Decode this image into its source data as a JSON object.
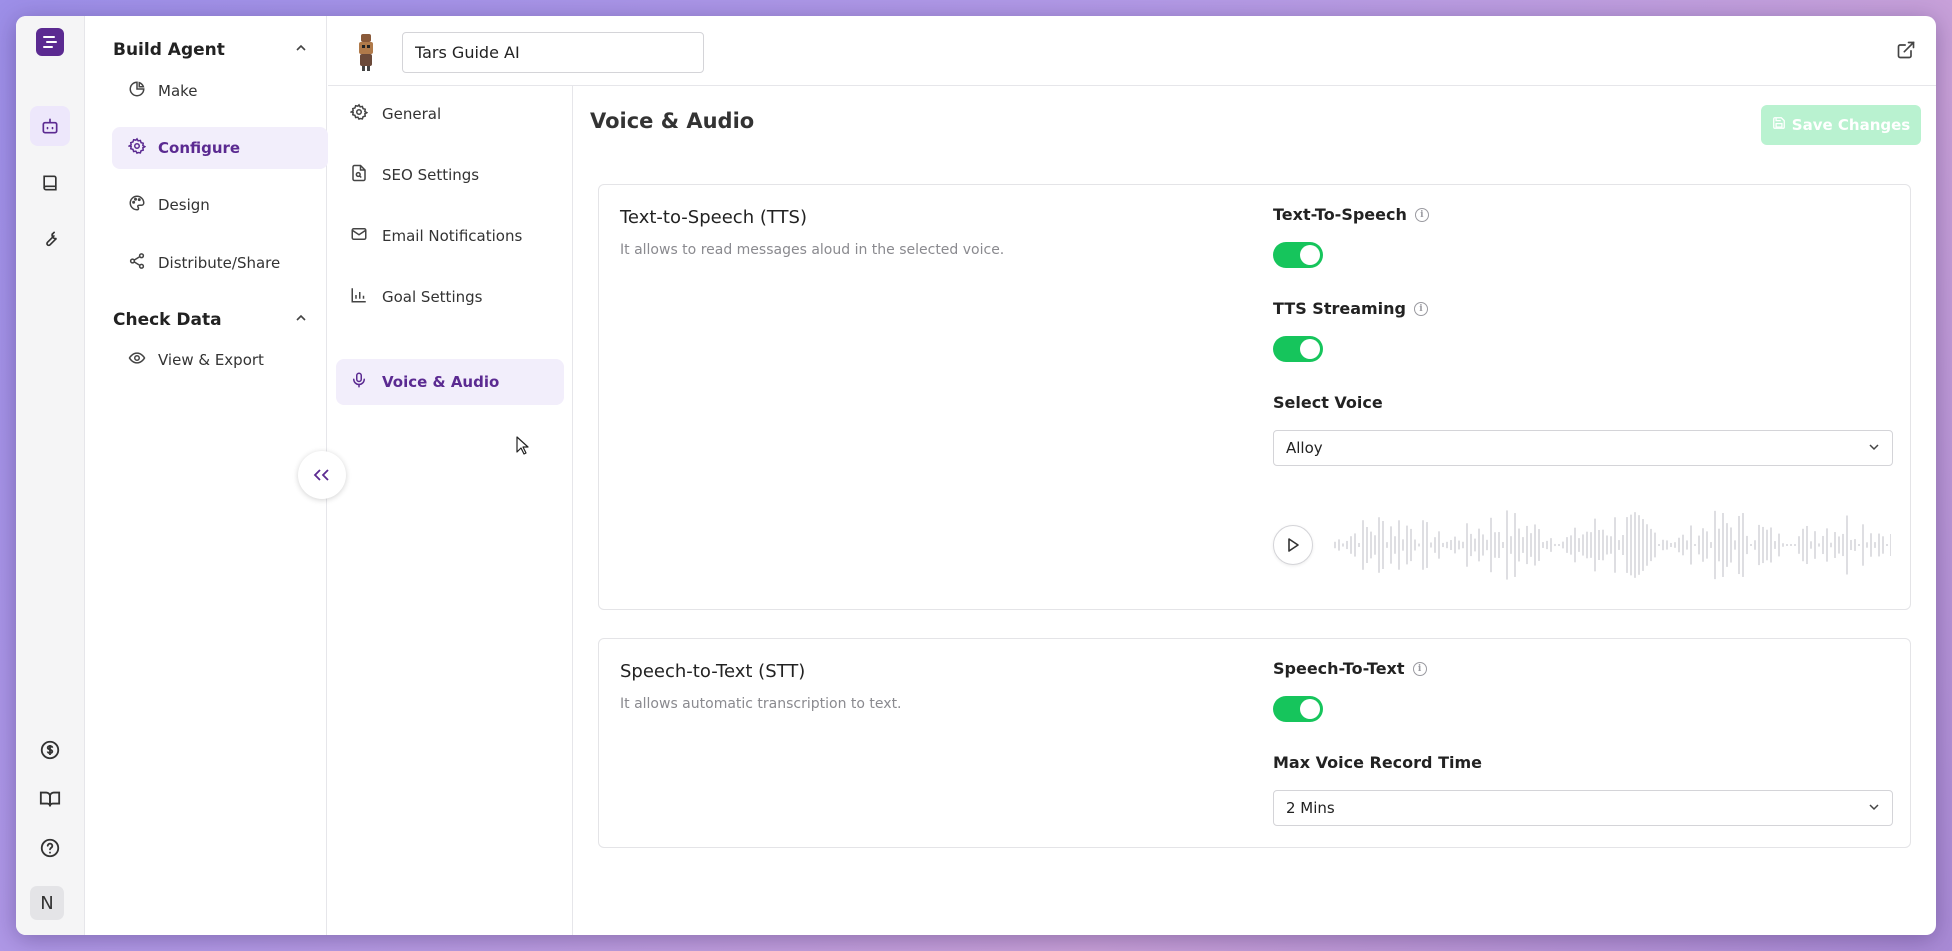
{
  "rail": {
    "top_icons": [
      "agent-icon",
      "book-icon",
      "wrench-icon"
    ],
    "bottom_icons": [
      "billing-icon",
      "docs-icon",
      "help-icon"
    ],
    "avatar_letter": "N"
  },
  "nav": {
    "sections": [
      {
        "label": "Build Agent",
        "items": [
          "Make",
          "Configure",
          "Design",
          "Distribute/Share"
        ]
      },
      {
        "label": "Check Data",
        "items": [
          "View & Export"
        ]
      }
    ],
    "active_item": "Configure"
  },
  "topbar": {
    "agent_name": "Tars Guide AI"
  },
  "submenu": {
    "items": [
      "General",
      "SEO Settings",
      "Email Notifications",
      "Goal Settings",
      "Voice & Audio"
    ],
    "active": "Voice & Audio"
  },
  "main": {
    "title": "Voice & Audio",
    "save_label": "Save Changes",
    "tts": {
      "title": "Text-to-Speech (TTS)",
      "description": "It allows to read messages aloud in the selected voice.",
      "toggle_label": "Text-To-Speech",
      "toggle_on": true,
      "streaming_label": "TTS Streaming",
      "streaming_on": true,
      "voice_label": "Select Voice",
      "voice_value": "Alloy"
    },
    "stt": {
      "title": "Speech-to-Text (STT)",
      "description": "It allows automatic transcription to text.",
      "toggle_label": "Speech-To-Text",
      "toggle_on": true,
      "record_label": "Max Voice Record Time",
      "record_value": "2 Mins"
    }
  },
  "colors": {
    "brand": "#5b2a91",
    "active_bg": "#f2eefb",
    "toggle_on": "#16c55c",
    "save_disabled": "#b9f2d0"
  }
}
